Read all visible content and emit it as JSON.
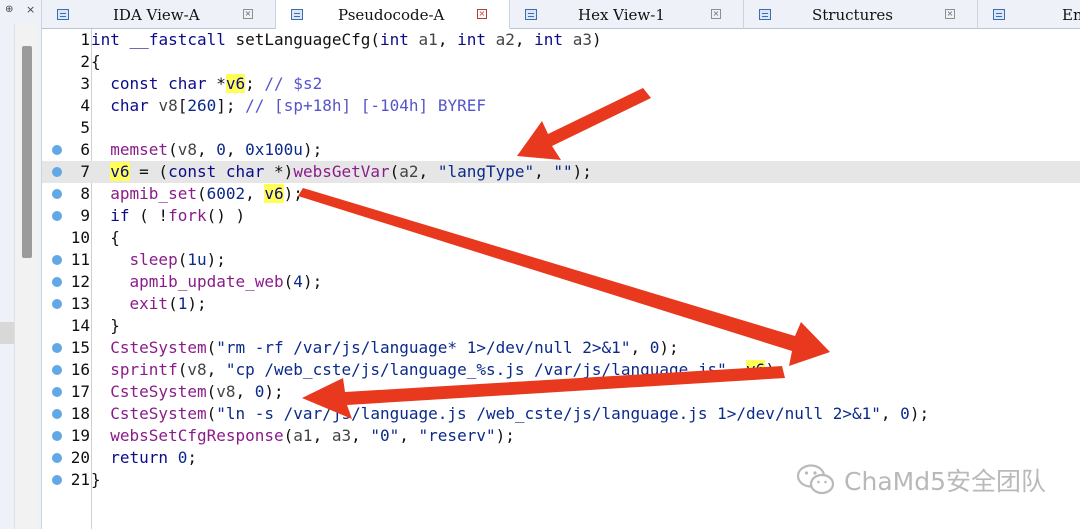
{
  "tabs": [
    {
      "label": "IDA View-A",
      "active": false
    },
    {
      "label": "Pseudocode-A",
      "active": true
    },
    {
      "label": "Hex View-1",
      "active": false
    },
    {
      "label": "Structures",
      "active": false
    },
    {
      "label": "En",
      "active": false
    }
  ],
  "tab_close_glyph": "×",
  "left_dock": {
    "pin_glyph": "⊕",
    "close_glyph": "×"
  },
  "code_lines": [
    {
      "num": "1",
      "bp": false,
      "text": "int __fastcall setLanguageCfg(int a1, int a2, int a3)"
    },
    {
      "num": "2",
      "bp": false,
      "text": "{"
    },
    {
      "num": "3",
      "bp": false,
      "text": "  const char *v6; // $s2"
    },
    {
      "num": "4",
      "bp": false,
      "text": "  char v8[260]; // [sp+18h] [-104h] BYREF"
    },
    {
      "num": "5",
      "bp": false,
      "text": ""
    },
    {
      "num": "6",
      "bp": true,
      "text": "  memset(v8, 0, 0x100u);"
    },
    {
      "num": "7",
      "bp": true,
      "text": "  v6 = (const char *)websGetVar(a2, \"langType\", \"\");"
    },
    {
      "num": "8",
      "bp": true,
      "text": "  apmib_set(6002, v6);"
    },
    {
      "num": "9",
      "bp": true,
      "text": "  if ( !fork() )"
    },
    {
      "num": "10",
      "bp": false,
      "text": "  {"
    },
    {
      "num": "11",
      "bp": true,
      "text": "    sleep(1u);"
    },
    {
      "num": "12",
      "bp": true,
      "text": "    apmib_update_web(4);"
    },
    {
      "num": "13",
      "bp": true,
      "text": "    exit(1);"
    },
    {
      "num": "14",
      "bp": false,
      "text": "  }"
    },
    {
      "num": "15",
      "bp": true,
      "text": "  CsteSystem(\"rm -rf /var/js/language* 1>/dev/null 2>&1\", 0);"
    },
    {
      "num": "16",
      "bp": true,
      "text": "  sprintf(v8, \"cp /web_cste/js/language_%s.js /var/js/language.js\", v6);"
    },
    {
      "num": "17",
      "bp": true,
      "text": "  CsteSystem(v8, 0);"
    },
    {
      "num": "18",
      "bp": true,
      "text": "  CsteSystem(\"ln -s /var/js/language.js /web_cste/js/language.js 1>/dev/null 2>&1\", 0);"
    },
    {
      "num": "19",
      "bp": true,
      "text": "  websSetCfgResponse(a1, a3, \"0\", \"reserv\");"
    },
    {
      "num": "20",
      "bp": true,
      "text": "  return 0;"
    },
    {
      "num": "21",
      "bp": true,
      "text": "}"
    }
  ],
  "highlighted_line": 7,
  "watermark": {
    "text": "ChaMd5安全团队"
  },
  "colors": {
    "arrow": "#e8391f",
    "breakpoint": "#62a7e6",
    "highlight": "#ffff55",
    "current_line": "#e6e6e6"
  }
}
